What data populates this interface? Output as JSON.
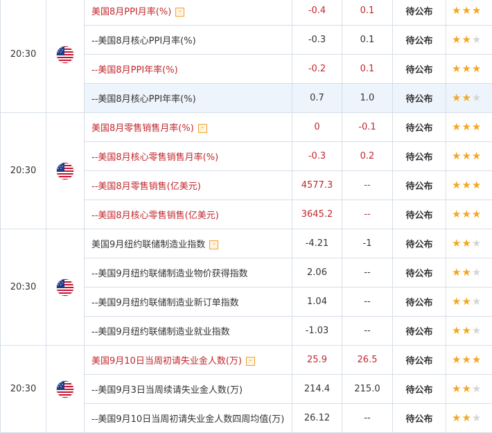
{
  "groups": [
    {
      "time": "20:30",
      "rows": [
        {
          "name": "美国8月PPI月率(%)",
          "actual": "-0.4",
          "forecast": "0.1",
          "status": "待公布",
          "stars": 3,
          "color": "red",
          "expand": true,
          "hl": false
        },
        {
          "name": "--美国8月核心PPI月率(%)",
          "actual": "-0.3",
          "forecast": "0.1",
          "status": "待公布",
          "stars": 2,
          "color": "dark",
          "expand": false,
          "hl": false
        },
        {
          "name": "--美国8月PPI年率(%)",
          "actual": "-0.2",
          "forecast": "0.1",
          "status": "待公布",
          "stars": 3,
          "color": "red",
          "expand": false,
          "hl": false
        },
        {
          "name": "--美国8月核心PPI年率(%)",
          "actual": "0.7",
          "forecast": "1.0",
          "status": "待公布",
          "stars": 2,
          "color": "dark",
          "expand": false,
          "hl": true
        }
      ]
    },
    {
      "time": "20:30",
      "rows": [
        {
          "name": "美国8月零售销售月率(%)",
          "actual": "0",
          "forecast": "-0.1",
          "status": "待公布",
          "stars": 3,
          "color": "red",
          "expand": true,
          "hl": false
        },
        {
          "name": "--美国8月核心零售销售月率(%)",
          "actual": "-0.3",
          "forecast": "0.2",
          "status": "待公布",
          "stars": 3,
          "color": "red",
          "expand": false,
          "hl": false
        },
        {
          "name": "--美国8月零售销售(亿美元)",
          "actual": "4577.3",
          "forecast": "--",
          "status": "待公布",
          "stars": 3,
          "color": "red",
          "expand": false,
          "hl": false
        },
        {
          "name": "--美国8月核心零售销售(亿美元)",
          "actual": "3645.2",
          "forecast": "--",
          "status": "待公布",
          "stars": 3,
          "color": "red",
          "expand": false,
          "hl": false
        }
      ]
    },
    {
      "time": "20:30",
      "rows": [
        {
          "name": "美国9月纽约联储制造业指数",
          "actual": "-4.21",
          "forecast": "-1",
          "status": "待公布",
          "stars": 2,
          "color": "dark",
          "expand": true,
          "hl": false
        },
        {
          "name": "--美国9月纽约联储制造业物价获得指数",
          "actual": "2.06",
          "forecast": "--",
          "status": "待公布",
          "stars": 2,
          "color": "dark",
          "expand": false,
          "hl": false
        },
        {
          "name": "--美国9月纽约联储制造业新订单指数",
          "actual": "1.04",
          "forecast": "--",
          "status": "待公布",
          "stars": 2,
          "color": "dark",
          "expand": false,
          "hl": false
        },
        {
          "name": "--美国9月纽约联储制造业就业指数",
          "actual": "-1.03",
          "forecast": "--",
          "status": "待公布",
          "stars": 2,
          "color": "dark",
          "expand": false,
          "hl": false
        }
      ]
    },
    {
      "time": "20:30",
      "rows": [
        {
          "name": "美国9月10日当周初请失业金人数(万)",
          "actual": "25.9",
          "forecast": "26.5",
          "status": "待公布",
          "stars": 3,
          "color": "red",
          "expand": true,
          "hl": false
        },
        {
          "name": "--美国9月3日当周续请失业金人数(万)",
          "actual": "214.4",
          "forecast": "215.0",
          "status": "待公布",
          "stars": 2,
          "color": "dark",
          "expand": false,
          "hl": false
        },
        {
          "name": "--美国9月10日当周初请失业金人数四周均值(万)",
          "actual": "26.12",
          "forecast": "--",
          "status": "待公布",
          "stars": 2,
          "color": "dark",
          "expand": false,
          "hl": false
        }
      ]
    }
  ],
  "expand_glyph": "-",
  "flag_icon": "us-flag-icon",
  "star_icon": "star-icon",
  "colors": {
    "red": "#c1272d",
    "dark": "#333333",
    "star_on": "#f5a623",
    "star_off": "#d5d5d5",
    "border": "#d6dde8",
    "highlight": "#eef4fc"
  }
}
